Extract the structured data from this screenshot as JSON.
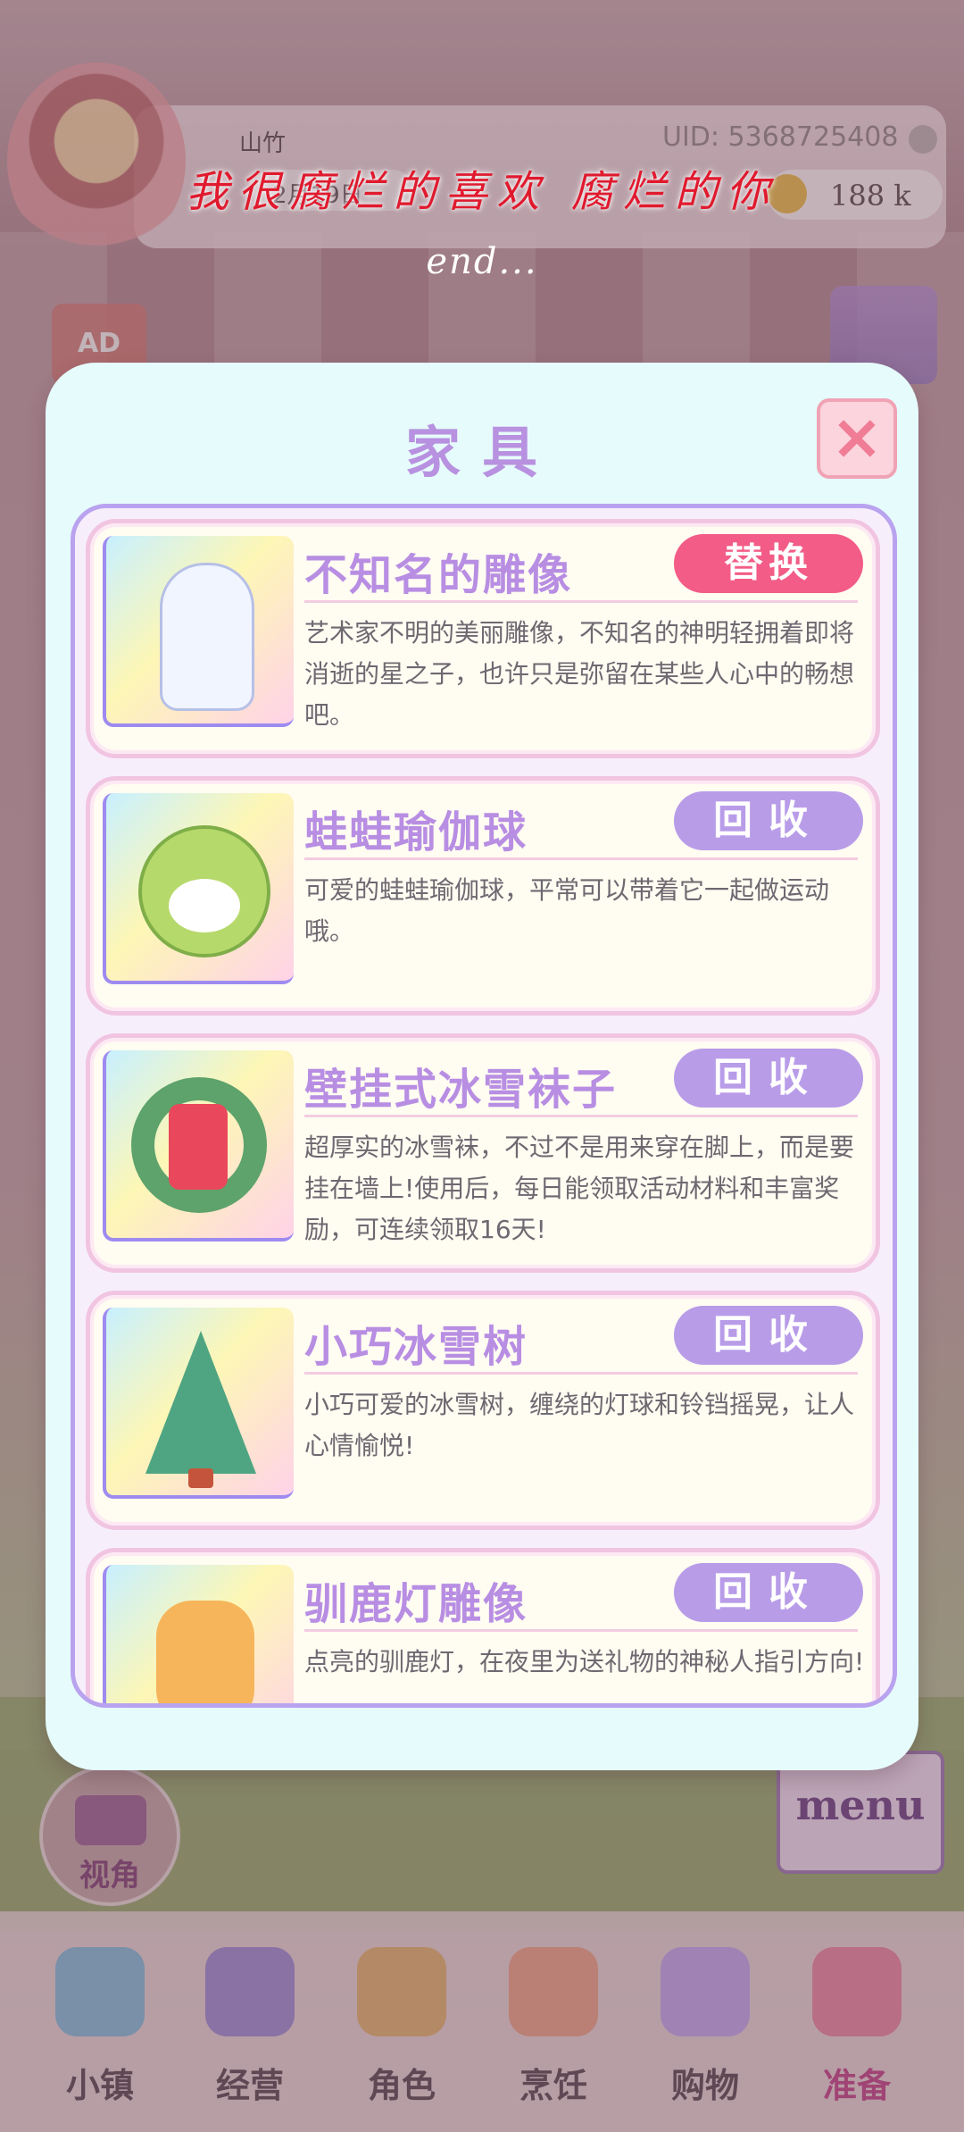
{
  "header": {
    "player_name": "山竹",
    "uid": "UID: 5368725408",
    "date": "2月19日",
    "coins": "188  k"
  },
  "lyrics": {
    "line1": "我很腐烂的喜欢 腐烂的你",
    "line2": "end..."
  },
  "side": {
    "ad_label": "AD",
    "view_label": "视角",
    "menu_label": "menu"
  },
  "modal": {
    "title": "家具",
    "close_icon": "close-icon",
    "items": [
      {
        "name": "不知名的雕像",
        "action": "替换",
        "action_type": "replace",
        "icon": "statue-icon",
        "description": "艺术家不明的美丽雕像，不知名的神明轻拥着即将消逝的星之子，也许只是弥留在某些人心中的畅想吧。"
      },
      {
        "name": "蛙蛙瑜伽球",
        "action": "回收",
        "action_type": "recycle",
        "icon": "frog-ball-icon",
        "description": "可爱的蛙蛙瑜伽球，平常可以带着它一起做运动哦。"
      },
      {
        "name": "壁挂式冰雪袜子",
        "action": "回收",
        "action_type": "recycle",
        "icon": "stocking-wreath-icon",
        "description": "超厚实的冰雪袜，不过不是用来穿在脚上，而是要挂在墙上!使用后，每日能领取活动材料和丰富奖励，可连续领取16天!"
      },
      {
        "name": "小巧冰雪树",
        "action": "回收",
        "action_type": "recycle",
        "icon": "christmas-tree-icon",
        "description": "小巧可爱的冰雪树，缠绕的灯球和铃铛摇晃，让人心情愉悦!"
      },
      {
        "name": "驯鹿灯雕像",
        "action": "回收",
        "action_type": "recycle",
        "icon": "reindeer-lamp-icon",
        "description": "点亮的驯鹿灯，在夜里为送礼物的神秘人指引方向!"
      }
    ]
  },
  "bottom_nav": [
    {
      "label": "小镇",
      "icon": "town-map-icon",
      "color": "#8fb7d6"
    },
    {
      "label": "经营",
      "icon": "top-hat-icon",
      "color": "#a58fd0"
    },
    {
      "label": "角色",
      "icon": "character-icon",
      "color": "#e0b07a"
    },
    {
      "label": "烹饪",
      "icon": "sandwich-icon",
      "color": "#e8a38f"
    },
    {
      "label": "购物",
      "icon": "shopping-bag-icon",
      "color": "#c5a6e6"
    },
    {
      "label": "准备",
      "icon": "basket-icon",
      "color": "#e58aa5",
      "active": true
    }
  ]
}
